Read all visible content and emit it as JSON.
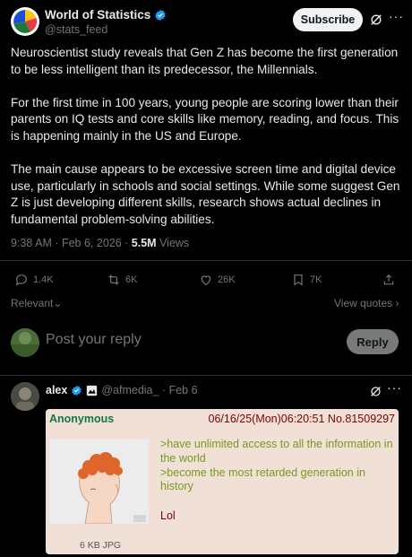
{
  "post": {
    "author_name": "World of Statistics",
    "author_handle": "@stats_feed",
    "subscribe_label": "Subscribe",
    "more_label": "···",
    "paragraphs": [
      "Neuroscientist study reveals that Gen Z has become the first generation to be less intelligent than its predecessor, the Millennials.",
      "For the first time in 100 years, young people are scoring lower than their parents on IQ tests and core skills like memory, reading, and focus. This is happening mainly in the US and Europe.",
      "The main cause appears to be excessive screen time and digital device use, particularly in schools and social settings. While some suggest Gen Z is just developing different skills, research shows actual declines in fundamental problem-solving abilities."
    ],
    "timestamp": "9:38 AM · Feb 6, 2026 · ",
    "views_count": "5.5M",
    "views_label": " Views"
  },
  "actions": {
    "replies": "1.4K",
    "reposts": "6K",
    "likes": "26K",
    "bookmarks": "7K"
  },
  "sort": {
    "relevant_label": "Relevant",
    "view_quotes_label": "View quotes"
  },
  "reply_box": {
    "placeholder": "Post your reply",
    "button_label": "Reply"
  },
  "reply": {
    "author_name": "alex",
    "handle_date": "@afmedia_ · Feb 6",
    "more_label": "···",
    "card": {
      "name": "Anonymous",
      "datetime": "06/16/25(Mon)06:20:51 No.81509297",
      "greentext": [
        ">have unlimited access to all the information in the world",
        ">become the most retarded generation in history"
      ],
      "closing": "Lol",
      "file_info": "6 KB JPG"
    }
  },
  "colors": {
    "accent_blue": "#1d9bf0",
    "text_primary": "#e7e9ea",
    "text_secondary": "#71767b",
    "chan_green": "#117743",
    "chan_greentext": "#789922",
    "chan_maroon": "#800000",
    "chan_bg": "#f0e0d6"
  }
}
